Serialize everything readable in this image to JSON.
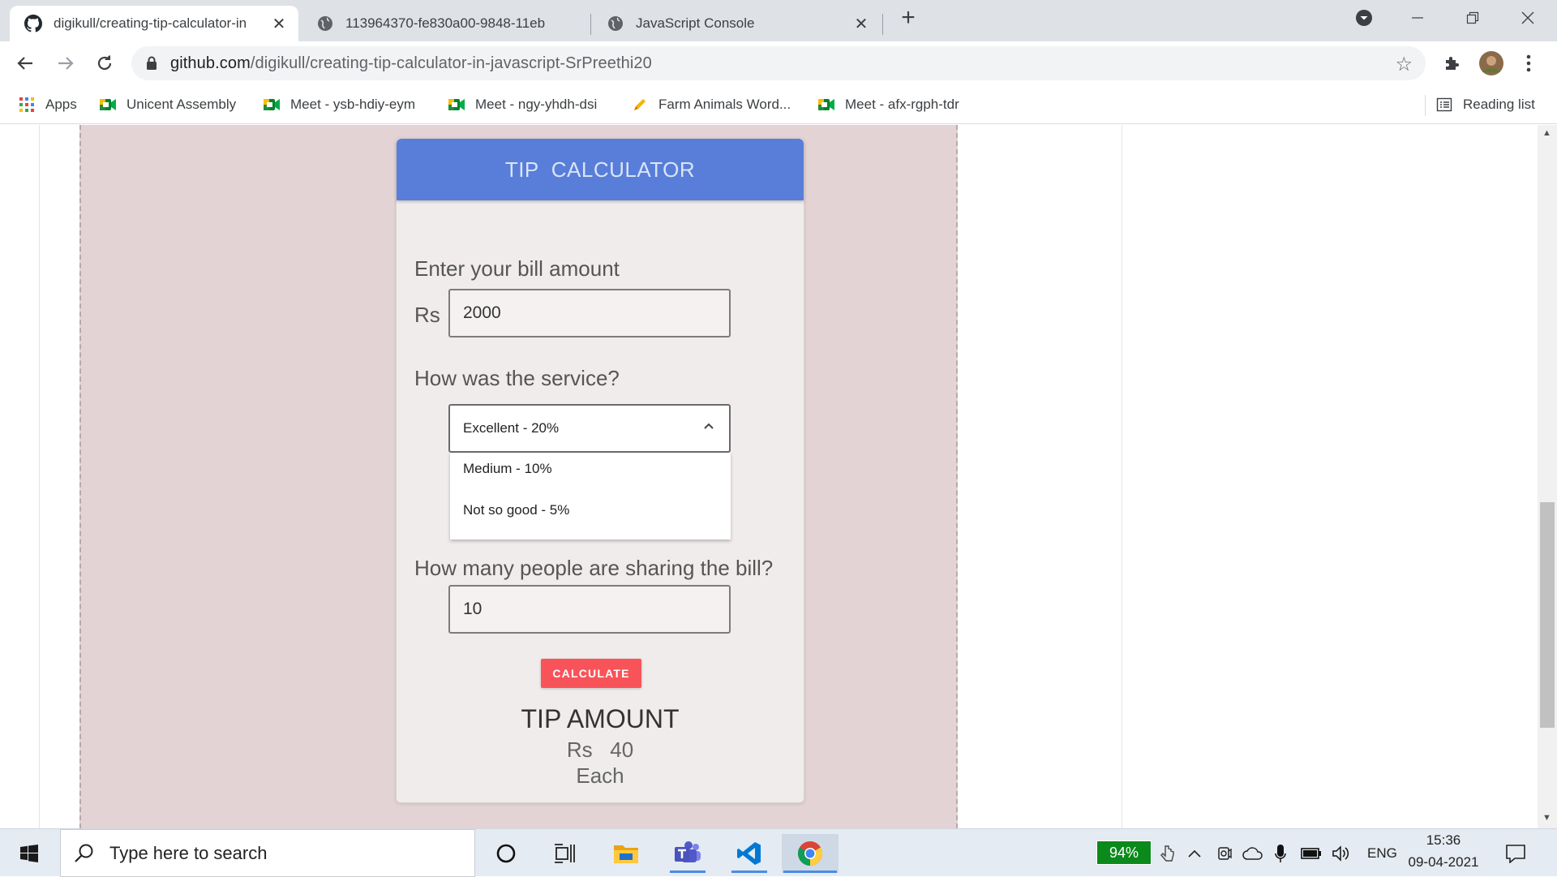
{
  "browser": {
    "tabs": [
      {
        "title": "digikull/creating-tip-calculator-in",
        "icon": "github-icon",
        "active": true
      },
      {
        "title": "113964370-fe830a00-9848-11eb",
        "icon": "globe-icon",
        "active": false
      },
      {
        "title": "JavaScript Console",
        "icon": "globe-icon",
        "active": false
      }
    ],
    "url_domain": "github.com",
    "url_path": "/digikull/creating-tip-calculator-in-javascript-SrPreethi20",
    "bookmarks": [
      {
        "label": "Apps",
        "icon": "apps-grid-icon"
      },
      {
        "label": "Unicent Assembly",
        "icon": "meet-icon"
      },
      {
        "label": "Meet - ysb-hdiy-eym",
        "icon": "meet-icon"
      },
      {
        "label": "Meet - ngy-yhdh-dsi",
        "icon": "meet-icon"
      },
      {
        "label": "Farm Animals Word...",
        "icon": "pencil-icon"
      },
      {
        "label": "Meet - afx-rgph-tdr",
        "icon": "meet-icon"
      }
    ],
    "reading_list": "Reading list"
  },
  "calculator": {
    "header": "TIP  CALCULATOR",
    "bill_label": "Enter your bill amount",
    "currency": "Rs",
    "bill_value": "2000",
    "service_label": "How was the service?",
    "service_selected": "Excellent - 20%",
    "service_options": [
      "Medium - 10%",
      "Not so good - 5%"
    ],
    "people_label": "How many people are sharing the bill?",
    "people_value": "10",
    "calculate_label": "CALCULATE",
    "tip_title": "TIP AMOUNT",
    "tip_amount": "Rs   40",
    "tip_each": "Each"
  },
  "taskbar": {
    "search_placeholder": "Type here to search",
    "battery": "94%",
    "language": "ENG",
    "time": "15:36",
    "date": "09-04-2021"
  },
  "colors": {
    "header_blue": "#587ed9",
    "calculate_red": "#f9535a",
    "preview_bg": "#e3d3d5"
  }
}
